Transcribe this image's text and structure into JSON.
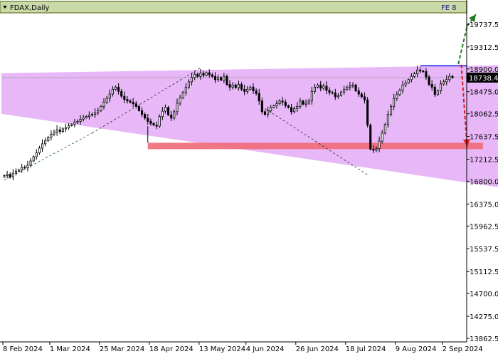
{
  "window": {
    "title": "FDAX,Daily",
    "corner_label": "FE 8"
  },
  "colors": {
    "background": "#ffffff",
    "channel_fill": "#e6b3f7",
    "support_zone": "#f06a78",
    "resistance_line": "#4a4ae8",
    "bull_arrow": "#1e7a1e",
    "bear_arrow": "#e01b1b",
    "candle": "#000000",
    "trendline": "#3a3a3a",
    "title_bar": "#c9d9a8"
  },
  "chart_data": {
    "type": "candlestick",
    "symbol": "FDAX",
    "timeframe": "Daily",
    "ylim": [
      13862.5,
      20162.5
    ],
    "y_ticks": [
      "19737.5",
      "19312.5",
      "18900.0",
      "18475.0",
      "18062.5",
      "17637.5",
      "17212.5",
      "16800.0",
      "16375.0",
      "15962.5",
      "15537.5",
      "15112.5",
      "14700.0",
      "14275.0",
      "13862.5"
    ],
    "x_ticks": [
      "8 Feb 2024",
      "1 Mar 2024",
      "25 Mar 2024",
      "18 Apr 2024",
      "13 May 2024",
      "4 Jun 2024",
      "26 Jun 2024",
      "18 Jul 2024",
      "9 Aug 2024",
      "2 Sep 2024"
    ],
    "current_price": "18738.4",
    "closes": [
      16905,
      16930,
      16880,
      16950,
      16990,
      17010,
      17060,
      17050,
      17100,
      17180,
      17260,
      17330,
      17420,
      17500,
      17560,
      17620,
      17680,
      17720,
      17760,
      17730,
      17780,
      17800,
      17840,
      17860,
      17900,
      17920,
      17960,
      17990,
      18010,
      18040,
      18050,
      18080,
      18120,
      18200,
      18280,
      18350,
      18430,
      18520,
      18560,
      18480,
      18390,
      18330,
      18300,
      18280,
      18250,
      18200,
      18120,
      18050,
      17980,
      17920,
      17880,
      17850,
      17830,
      18010,
      18110,
      18180,
      18040,
      17980,
      18100,
      18260,
      18360,
      18460,
      18560,
      18660,
      18740,
      18800,
      18760,
      18820,
      18780,
      18830,
      18790,
      18760,
      18700,
      18740,
      18690,
      18760,
      18610,
      18560,
      18600,
      18550,
      18610,
      18520,
      18480,
      18520,
      18560,
      18490,
      18440,
      18300,
      18100,
      18050,
      18120,
      18180,
      18210,
      18250,
      18300,
      18280,
      18210,
      18180,
      18100,
      18160,
      18200,
      18300,
      18240,
      18260,
      18300,
      18480,
      18560,
      18600,
      18540,
      18580,
      18500,
      18460,
      18450,
      18380,
      18400,
      18470,
      18520,
      18560,
      18580,
      18600,
      18490,
      18430,
      18380,
      18320,
      17850,
      17400,
      17380,
      17410,
      17550,
      17700,
      17860,
      18050,
      18200,
      18350,
      18420,
      18500,
      18600,
      18640,
      18700,
      18760,
      18810,
      18880,
      18860,
      18850,
      18750,
      18610,
      18560,
      18420,
      18490,
      18620,
      18660,
      18700,
      18760,
      18738.4
    ],
    "channel": {
      "upper": {
        "x_index": [
          0,
          160
        ],
        "price": [
          18820,
          18970
        ]
      },
      "lower": {
        "x_index": [
          0,
          160
        ],
        "price": [
          18060,
          16690
        ]
      }
    },
    "support_zone": {
      "start_index": 49,
      "end_index": 160,
      "price_low": 17400,
      "price_high": 17520
    },
    "resistance_line": {
      "start_index": 142,
      "end_index": 158,
      "price": 18960
    },
    "trendlines": [
      {
        "style": "dashed",
        "color": "bull_arrow",
        "x_index": [
          0,
          30
        ],
        "price": [
          16820,
          17700
        ]
      },
      {
        "style": "dashed",
        "color": "trendline",
        "x_index": [
          30,
          67
        ],
        "price": [
          17700,
          18920
        ]
      },
      {
        "style": "dashed",
        "color": "trendline",
        "x_index": [
          89,
          124
        ],
        "price": [
          18160,
          16920
        ]
      }
    ],
    "forecast_arrows": [
      {
        "direction": "up",
        "color": "bull_arrow",
        "x_index": [
          155,
          158,
          161
        ],
        "price": [
          18990,
          19700,
          19920
        ]
      },
      {
        "direction": "down",
        "color": "bear_arrow",
        "x_index": [
          156,
          158
        ],
        "price": [
          18980,
          17450
        ]
      }
    ]
  }
}
